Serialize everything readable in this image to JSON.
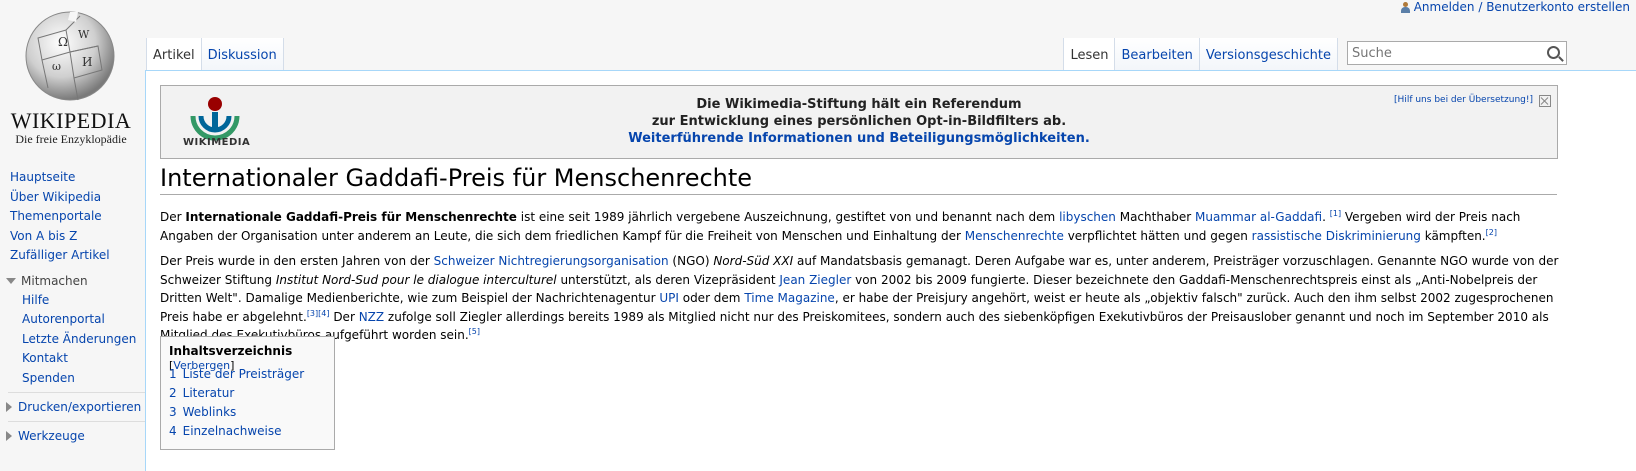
{
  "personal": {
    "login_label": "Anmelden / Benutzerkonto erstellen"
  },
  "logo": {
    "wordmark": "WIKIPEDIA",
    "tagline": "Die freie Enzyklopädie"
  },
  "sidebar": {
    "navigation": [
      "Hauptseite",
      "Über Wikipedia",
      "Themenportale",
      "Von A bis Z",
      "Zufälliger Artikel"
    ],
    "mitmachen_label": "Mitmachen",
    "mitmachen_items": [
      "Hilfe",
      "Autorenportal",
      "Letzte Änderungen",
      "Kontakt",
      "Spenden"
    ],
    "print_export_label": "Drucken/exportieren",
    "tools_label": "Werkzeuge"
  },
  "tabs": {
    "left": [
      "Artikel",
      "Diskussion"
    ],
    "right": [
      "Lesen",
      "Bearbeiten",
      "Versionsgeschichte"
    ],
    "selected_left": "Artikel",
    "selected_right": "Lesen"
  },
  "search": {
    "placeholder": "Suche"
  },
  "banner": {
    "logo_text": "WIKIMEDIA",
    "line1": "Die Wikimedia-Stiftung hält ein Referendum",
    "line2": "zur Entwicklung eines persönlichen Opt-in-Bildfilters ab.",
    "line3": "Weiterführende Informationen und Beteiligungsmöglichkeiten.",
    "help_link": "[Hilf uns bei der Übersetzung!]"
  },
  "article": {
    "title": "Internationaler Gaddafi-Preis für Menschenrechte",
    "p1": {
      "t1": "Der ",
      "b1": "Internationale Gaddafi-Preis für Menschenrechte",
      "t2": " ist eine seit 1989 jährlich vergebene Auszeichnung, gestiftet von und benannt nach dem ",
      "l1": "libyschen",
      "t3": " Machthaber ",
      "l2": "Muammar al-Gaddafi",
      "t4": ". ",
      "r1": "[1]",
      "t5": " Vergeben wird der Preis nach Angaben der Organisation unter anderem an Leute, die sich dem friedlichen Kampf für die Freiheit von Menschen und Einhaltung der ",
      "l3": "Menschenrechte",
      "t6": " verpflichtet hätten und gegen ",
      "l4": "rassistische Diskriminierung",
      "t7": " kämpften.",
      "r2": "[2]"
    },
    "p2": {
      "t1": "Der Preis wurde in den ersten Jahren von der ",
      "l1": "Schweizer Nichtregierungsorganisation",
      "t2": " (NGO) ",
      "i1": "Nord-Süd XXI",
      "t3": " auf Mandatsbasis gemanagt. Deren Aufgabe war es, unter anderem, Preisträger vorzuschlagen. Genannte NGO wurde von der Schweizer Stiftung ",
      "i2": "Institut Nord-Sud pour le dialogue interculturel",
      "t4": " unterstützt, als deren Vizepräsident ",
      "l2": "Jean Ziegler",
      "t5": " von 2002 bis 2009 fungierte. Dieser bezeichnete den Gaddafi-Menschenrechtspreis einst als „Anti-Nobelpreis der Dritten Welt\". Damalige Medienberichte, wie zum Beispiel der Nachrichtenagentur ",
      "l3": "UPI",
      "t6": " oder dem ",
      "l4": "Time Magazine",
      "t7": ", er habe der Preisjury angehört, weist er heute als „objektiv falsch\" zurück. Auch den ihm selbst 2002 zugesprochenen Preis habe er abgelehnt.",
      "r1": "[3]",
      "r2": "[4]",
      "t8": " Der ",
      "l5": "NZZ",
      "t9": " zufolge soll Ziegler allerdings bereits 1989 als Mitglied nicht nur des Preiskomitees, sondern auch des siebenköpfigen Exekutivbüros der Preisauslober genannt und noch im September 2010 als Mitglied des Exekutivbüros aufgeführt worden sein.",
      "r3": "[5]"
    }
  },
  "toc": {
    "title": "Inhaltsverzeichnis",
    "toggle_open": "[",
    "toggle_label": "Verbergen",
    "toggle_close": "]",
    "items": [
      {
        "num": "1",
        "label": "Liste der Preisträger"
      },
      {
        "num": "2",
        "label": "Literatur"
      },
      {
        "num": "3",
        "label": "Weblinks"
      },
      {
        "num": "4",
        "label": "Einzelnachweise"
      }
    ]
  },
  "colors": {
    "link": "#0645ad",
    "border": "#a7d7f9",
    "background": "#f6f6f6"
  }
}
